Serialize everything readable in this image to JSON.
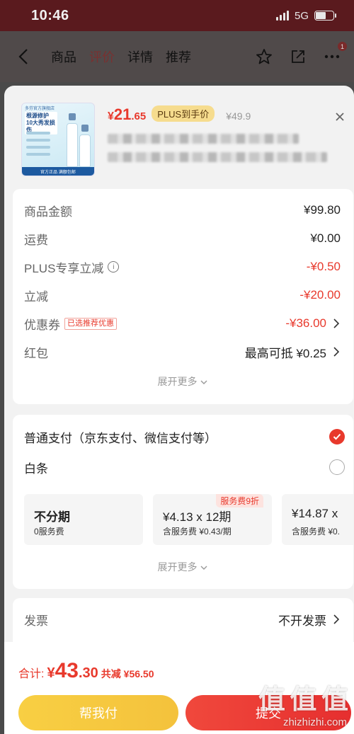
{
  "status": {
    "time": "10:46",
    "network": "5G"
  },
  "nav": {
    "tabs": [
      "商品",
      "评价",
      "详情",
      "推荐"
    ],
    "active_tab": 1,
    "share_badge": "1"
  },
  "product": {
    "image_text": {
      "brand": "多芬官方旗舰店",
      "headline": "根源修护 10大秀发损伤",
      "footer": "官方正品 满额包邮"
    },
    "price_symbol": "¥",
    "price_int": "21",
    "price_dec": ".65",
    "plus_tag": "PLUS到手价",
    "original_price": "¥49.9"
  },
  "fees": {
    "goods_amount": {
      "label": "商品金额",
      "value": "¥99.80"
    },
    "shipping": {
      "label": "运费",
      "value": "¥0.00"
    },
    "plus_discount": {
      "label": "PLUS专享立减",
      "value": "-¥0.50"
    },
    "instant_discount": {
      "label": "立减",
      "value": "-¥20.00"
    },
    "coupon": {
      "label": "优惠券",
      "badge": "已选推荐优惠",
      "value": "-¥36.00"
    },
    "red_packet": {
      "label": "红包",
      "value": "最高可抵 ¥0.25"
    },
    "expand": "展开更多"
  },
  "payment": {
    "normal": {
      "label": "普通支付（京东支付、微信支付等）",
      "selected": true
    },
    "baitiao": {
      "label": "白条",
      "selected": false
    },
    "plans": [
      {
        "main": "不分期",
        "sub": "0服务费"
      },
      {
        "main": "¥4.13 x 12期",
        "sub": "含服务费 ¥0.43/期",
        "tag": "服务费9折"
      },
      {
        "main": "¥14.87 x",
        "sub": "含服务费 ¥0."
      }
    ],
    "expand": "展开更多"
  },
  "invoice": {
    "label": "发票",
    "value": "不开发票"
  },
  "bottom": {
    "total_label": "合计:",
    "total_symbol": "¥",
    "total_int": "43",
    "total_dec": ".30",
    "saved": "共减 ¥56.50",
    "help_pay": "帮我付",
    "submit": "提交",
    "watermark_main": "值 值 值",
    "watermark_url": "zhizhizhi.com"
  },
  "colors": {
    "accent": "#e8392c",
    "plus": "#f6dc8e",
    "help_btn": "#f5c63e",
    "submit_btn": "#e8392c"
  }
}
